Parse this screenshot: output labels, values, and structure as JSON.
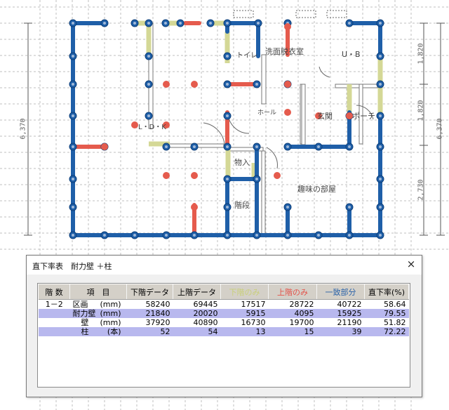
{
  "plan": {
    "dimensions": {
      "left_total": "6,370",
      "right_total": "6,370",
      "right_seg1": "1,820",
      "right_seg2": "1,820",
      "right_seg3": "2,730"
    },
    "rooms": [
      {
        "key": "toilet",
        "label": "トイレ"
      },
      {
        "key": "washroom",
        "label": "洗面脱衣室"
      },
      {
        "key": "ub",
        "label": "U・B"
      },
      {
        "key": "ldk",
        "label": "L・D・K"
      },
      {
        "key": "hall",
        "label": "ホール"
      },
      {
        "key": "entrance",
        "label": "玄関"
      },
      {
        "key": "porch",
        "label": "ポーチ"
      },
      {
        "key": "storage",
        "label": "物入"
      },
      {
        "key": "hobby",
        "label": "趣味の部屋"
      },
      {
        "key": "stairs",
        "label": "階段"
      }
    ],
    "colors": {
      "bearing_wall": "#1f5fa8",
      "lower_only": "#d4d896",
      "upper_only": "#e55b4d",
      "grid": "#bfbfbf"
    }
  },
  "dialog": {
    "title": "直下率表　耐力壁 ＋柱",
    "close_icon": "×",
    "headers": {
      "floor": "階 数",
      "item": "項　目",
      "lower": "下階データ",
      "upper": "上階データ",
      "lower_only": "下階のみ",
      "upper_only": "上階のみ",
      "match": "一致部分",
      "ratio": "直下率(%)"
    },
    "rows": [
      {
        "floor": "1－2",
        "item": "区画",
        "unit": "(mm)",
        "lower": "58240",
        "upper": "69445",
        "lower_only": "17517",
        "upper_only": "28722",
        "match": "40722",
        "ratio": "58.64"
      },
      {
        "floor": "",
        "item": "耐力壁",
        "unit": "(mm)",
        "lower": "21840",
        "upper": "20020",
        "lower_only": "5915",
        "upper_only": "4095",
        "match": "15925",
        "ratio": "79.55"
      },
      {
        "floor": "",
        "item": "壁",
        "unit": "(mm)",
        "lower": "37920",
        "upper": "40890",
        "lower_only": "16730",
        "upper_only": "19700",
        "match": "21190",
        "ratio": "51.82"
      },
      {
        "floor": "",
        "item": "柱",
        "unit": "(本)",
        "lower": "52",
        "upper": "54",
        "lower_only": "13",
        "upper_only": "15",
        "match": "39",
        "ratio": "72.22"
      }
    ]
  }
}
